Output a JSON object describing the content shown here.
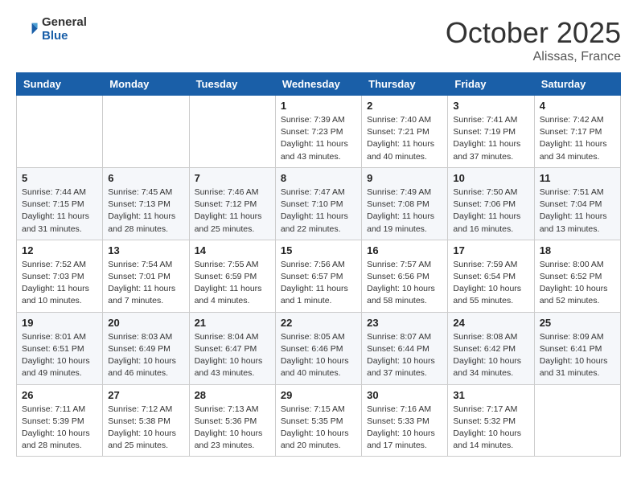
{
  "logo": {
    "text_general": "General",
    "text_blue": "Blue"
  },
  "header": {
    "month": "October 2025",
    "location": "Alissas, France"
  },
  "weekdays": [
    "Sunday",
    "Monday",
    "Tuesday",
    "Wednesday",
    "Thursday",
    "Friday",
    "Saturday"
  ],
  "weeks": [
    [
      null,
      null,
      null,
      {
        "day": "1",
        "sunrise": "Sunrise: 7:39 AM",
        "sunset": "Sunset: 7:23 PM",
        "daylight": "Daylight: 11 hours and 43 minutes."
      },
      {
        "day": "2",
        "sunrise": "Sunrise: 7:40 AM",
        "sunset": "Sunset: 7:21 PM",
        "daylight": "Daylight: 11 hours and 40 minutes."
      },
      {
        "day": "3",
        "sunrise": "Sunrise: 7:41 AM",
        "sunset": "Sunset: 7:19 PM",
        "daylight": "Daylight: 11 hours and 37 minutes."
      },
      {
        "day": "4",
        "sunrise": "Sunrise: 7:42 AM",
        "sunset": "Sunset: 7:17 PM",
        "daylight": "Daylight: 11 hours and 34 minutes."
      }
    ],
    [
      {
        "day": "5",
        "sunrise": "Sunrise: 7:44 AM",
        "sunset": "Sunset: 7:15 PM",
        "daylight": "Daylight: 11 hours and 31 minutes."
      },
      {
        "day": "6",
        "sunrise": "Sunrise: 7:45 AM",
        "sunset": "Sunset: 7:13 PM",
        "daylight": "Daylight: 11 hours and 28 minutes."
      },
      {
        "day": "7",
        "sunrise": "Sunrise: 7:46 AM",
        "sunset": "Sunset: 7:12 PM",
        "daylight": "Daylight: 11 hours and 25 minutes."
      },
      {
        "day": "8",
        "sunrise": "Sunrise: 7:47 AM",
        "sunset": "Sunset: 7:10 PM",
        "daylight": "Daylight: 11 hours and 22 minutes."
      },
      {
        "day": "9",
        "sunrise": "Sunrise: 7:49 AM",
        "sunset": "Sunset: 7:08 PM",
        "daylight": "Daylight: 11 hours and 19 minutes."
      },
      {
        "day": "10",
        "sunrise": "Sunrise: 7:50 AM",
        "sunset": "Sunset: 7:06 PM",
        "daylight": "Daylight: 11 hours and 16 minutes."
      },
      {
        "day": "11",
        "sunrise": "Sunrise: 7:51 AM",
        "sunset": "Sunset: 7:04 PM",
        "daylight": "Daylight: 11 hours and 13 minutes."
      }
    ],
    [
      {
        "day": "12",
        "sunrise": "Sunrise: 7:52 AM",
        "sunset": "Sunset: 7:03 PM",
        "daylight": "Daylight: 11 hours and 10 minutes."
      },
      {
        "day": "13",
        "sunrise": "Sunrise: 7:54 AM",
        "sunset": "Sunset: 7:01 PM",
        "daylight": "Daylight: 11 hours and 7 minutes."
      },
      {
        "day": "14",
        "sunrise": "Sunrise: 7:55 AM",
        "sunset": "Sunset: 6:59 PM",
        "daylight": "Daylight: 11 hours and 4 minutes."
      },
      {
        "day": "15",
        "sunrise": "Sunrise: 7:56 AM",
        "sunset": "Sunset: 6:57 PM",
        "daylight": "Daylight: 11 hours and 1 minute."
      },
      {
        "day": "16",
        "sunrise": "Sunrise: 7:57 AM",
        "sunset": "Sunset: 6:56 PM",
        "daylight": "Daylight: 10 hours and 58 minutes."
      },
      {
        "day": "17",
        "sunrise": "Sunrise: 7:59 AM",
        "sunset": "Sunset: 6:54 PM",
        "daylight": "Daylight: 10 hours and 55 minutes."
      },
      {
        "day": "18",
        "sunrise": "Sunrise: 8:00 AM",
        "sunset": "Sunset: 6:52 PM",
        "daylight": "Daylight: 10 hours and 52 minutes."
      }
    ],
    [
      {
        "day": "19",
        "sunrise": "Sunrise: 8:01 AM",
        "sunset": "Sunset: 6:51 PM",
        "daylight": "Daylight: 10 hours and 49 minutes."
      },
      {
        "day": "20",
        "sunrise": "Sunrise: 8:03 AM",
        "sunset": "Sunset: 6:49 PM",
        "daylight": "Daylight: 10 hours and 46 minutes."
      },
      {
        "day": "21",
        "sunrise": "Sunrise: 8:04 AM",
        "sunset": "Sunset: 6:47 PM",
        "daylight": "Daylight: 10 hours and 43 minutes."
      },
      {
        "day": "22",
        "sunrise": "Sunrise: 8:05 AM",
        "sunset": "Sunset: 6:46 PM",
        "daylight": "Daylight: 10 hours and 40 minutes."
      },
      {
        "day": "23",
        "sunrise": "Sunrise: 8:07 AM",
        "sunset": "Sunset: 6:44 PM",
        "daylight": "Daylight: 10 hours and 37 minutes."
      },
      {
        "day": "24",
        "sunrise": "Sunrise: 8:08 AM",
        "sunset": "Sunset: 6:42 PM",
        "daylight": "Daylight: 10 hours and 34 minutes."
      },
      {
        "day": "25",
        "sunrise": "Sunrise: 8:09 AM",
        "sunset": "Sunset: 6:41 PM",
        "daylight": "Daylight: 10 hours and 31 minutes."
      }
    ],
    [
      {
        "day": "26",
        "sunrise": "Sunrise: 7:11 AM",
        "sunset": "Sunset: 5:39 PM",
        "daylight": "Daylight: 10 hours and 28 minutes."
      },
      {
        "day": "27",
        "sunrise": "Sunrise: 7:12 AM",
        "sunset": "Sunset: 5:38 PM",
        "daylight": "Daylight: 10 hours and 25 minutes."
      },
      {
        "day": "28",
        "sunrise": "Sunrise: 7:13 AM",
        "sunset": "Sunset: 5:36 PM",
        "daylight": "Daylight: 10 hours and 23 minutes."
      },
      {
        "day": "29",
        "sunrise": "Sunrise: 7:15 AM",
        "sunset": "Sunset: 5:35 PM",
        "daylight": "Daylight: 10 hours and 20 minutes."
      },
      {
        "day": "30",
        "sunrise": "Sunrise: 7:16 AM",
        "sunset": "Sunset: 5:33 PM",
        "daylight": "Daylight: 10 hours and 17 minutes."
      },
      {
        "day": "31",
        "sunrise": "Sunrise: 7:17 AM",
        "sunset": "Sunset: 5:32 PM",
        "daylight": "Daylight: 10 hours and 14 minutes."
      },
      null
    ]
  ]
}
